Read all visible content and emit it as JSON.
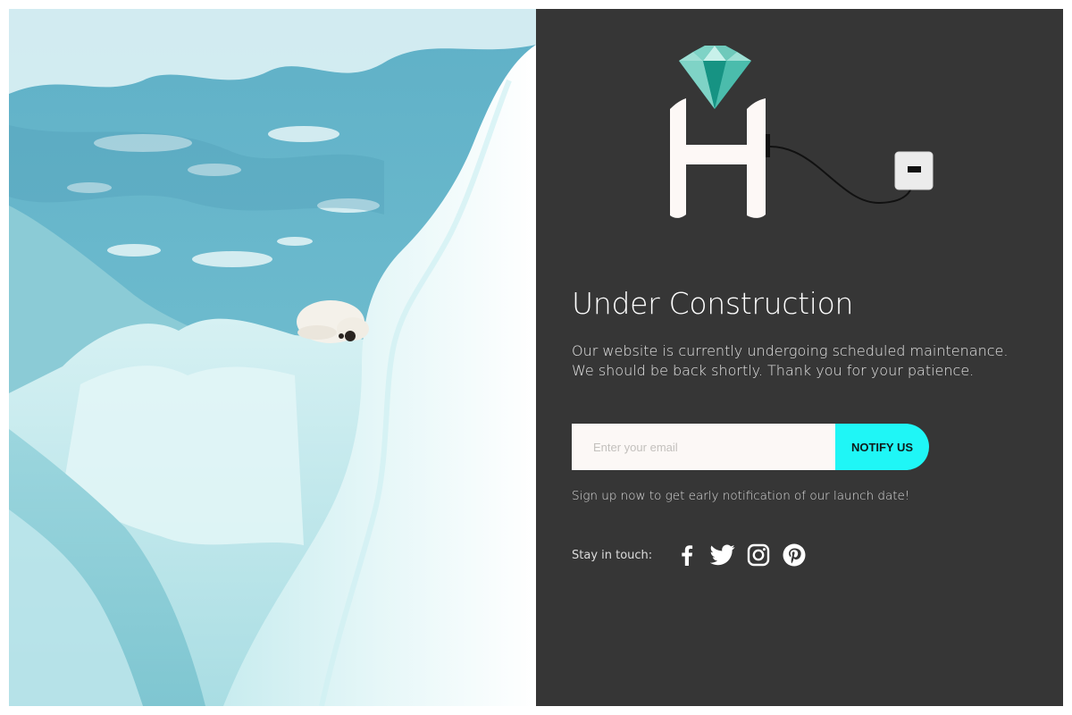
{
  "hero": {
    "title": "Under Construction",
    "description_lines": [
      "Our website is currently undergoing scheduled maintenance.",
      "We should be back shortly. Thank you for your patience."
    ]
  },
  "signup": {
    "email_placeholder": "Enter your email",
    "email_value": "",
    "button_label": "NOTIFY US",
    "note": "Sign up now to get early notification of our launch date!"
  },
  "social": {
    "label": "Stay in touch:",
    "icons": [
      "facebook-icon",
      "twitter-icon",
      "instagram-icon",
      "pinterest-icon"
    ]
  },
  "colors": {
    "panel_background": "#363636",
    "accent_button": "#1ff6f6",
    "input_background": "#fcf8f6",
    "logo_letter": "#fdf8f6",
    "gem_teal": "#26a69a"
  }
}
